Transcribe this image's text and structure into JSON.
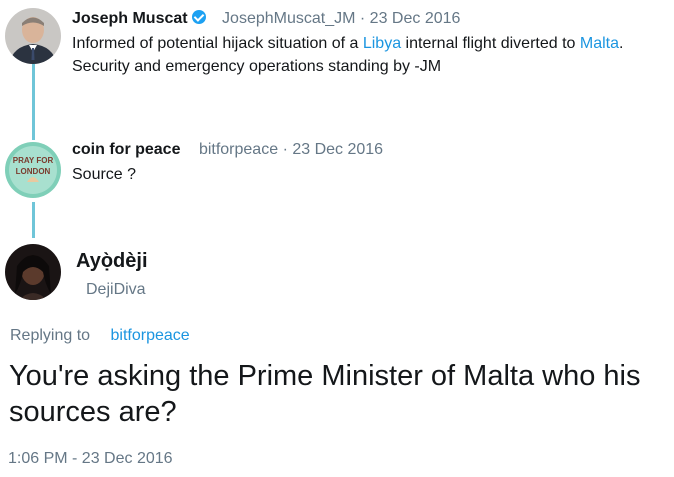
{
  "tweet1": {
    "name": "Joseph Muscat",
    "handle": "JosephMuscat_JM",
    "date": "23 Dec 2016",
    "text_part1": "Informed of potential hijack situation of a",
    "link1": "Libya",
    "text_part2": "internal flight diverted to",
    "link2": "Malta",
    "text_part3": ".",
    "text_line2": "Security and emergency operations standing by -JM"
  },
  "tweet2": {
    "name": "coin for peace",
    "handle": "bitforpeace",
    "date": "23 Dec 2016",
    "text": "Source ?",
    "avatar_text_line1": "PRAY FOR",
    "avatar_text_line2": "LONDON"
  },
  "main_tweet": {
    "name": "Ayọ̀dèji",
    "handle": "DejiDiva",
    "replying_label": "Replying to",
    "replying_handle": "bitforpeace",
    "text": "You're asking the Prime Minister of Malta who his sources are?",
    "timestamp": "1:06 PM - 23 Dec 2016"
  },
  "colors": {
    "link": "#1b95e0",
    "thread_line": "#6fc5d8",
    "muted": "#657786"
  }
}
